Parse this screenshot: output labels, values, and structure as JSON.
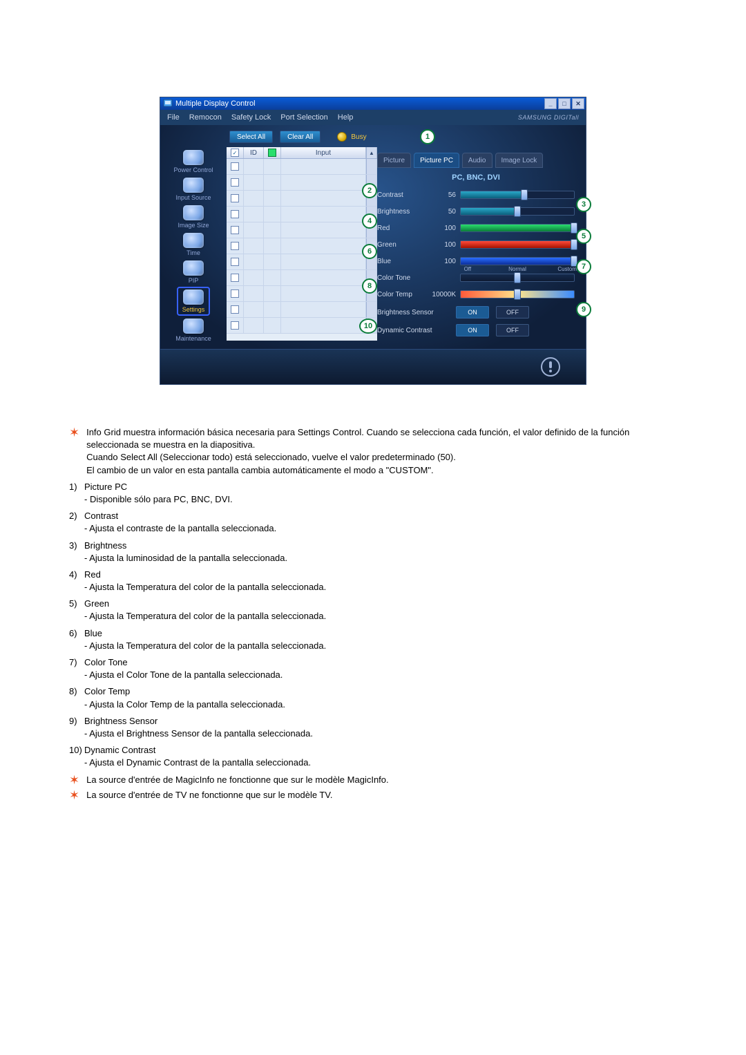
{
  "window": {
    "title": "Multiple Display Control",
    "brand": "SAMSUNG DIGITall"
  },
  "menu": {
    "file": "File",
    "remocon": "Remocon",
    "safety_lock": "Safety Lock",
    "port_selection": "Port Selection",
    "help": "Help"
  },
  "sidebar": {
    "items": [
      {
        "label": "Power Control"
      },
      {
        "label": "Input Source"
      },
      {
        "label": "Image Size"
      },
      {
        "label": "Time"
      },
      {
        "label": "PIP"
      },
      {
        "label": "Settings"
      },
      {
        "label": "Maintenance"
      }
    ]
  },
  "toolbar": {
    "select_all": "Select All",
    "clear_all": "Clear All",
    "busy": "Busy"
  },
  "grid": {
    "hdr_id": "ID",
    "hdr_input": "Input"
  },
  "tabs": {
    "picture": "Picture",
    "picture_pc": "Picture PC",
    "audio": "Audio",
    "image_lock": "Image Lock"
  },
  "panel": {
    "subtitle": "PC, BNC, DVI",
    "contrast": {
      "label": "Contrast",
      "value": "56",
      "pct": 56
    },
    "brightness": {
      "label": "Brightness",
      "value": "50",
      "pct": 50
    },
    "red": {
      "label": "Red",
      "value": "100",
      "pct": 100
    },
    "green": {
      "label": "Green",
      "value": "100",
      "pct": 100
    },
    "blue": {
      "label": "Blue",
      "value": "100",
      "pct": 100
    },
    "color_tone": {
      "label": "Color Tone",
      "ticks": [
        "Off",
        "Normal",
        "Custom"
      ],
      "pos": 50
    },
    "color_temp": {
      "label": "Color Temp",
      "value": "10000K",
      "pos": 50
    },
    "brightness_sensor": {
      "label": "Brightness Sensor",
      "on": "ON",
      "off": "OFF"
    },
    "dynamic_contrast": {
      "label": "Dynamic Contrast",
      "on": "ON",
      "off": "OFF"
    }
  },
  "callouts": {
    "c1": "1",
    "c2": "2",
    "c3": "3",
    "c4": "4",
    "c5": "5",
    "c6": "6",
    "c7": "7",
    "c8": "8",
    "c9": "9",
    "c10": "10"
  },
  "explain": {
    "intro1": "Info Grid muestra información básica necesaria para Settings Control. Cuando se selecciona cada función, el valor definido de la función seleccionada se muestra en la diapositiva.",
    "intro2": "Cuando Select All (Seleccionar todo) está seleccionado, vuelve el valor predeterminado (50).",
    "intro3": "El cambio de un valor en esta pantalla cambia automáticamente el modo a \"CUSTOM\".",
    "items": [
      {
        "n": "1)",
        "t": "Picture PC",
        "s": "- Disponible sólo para PC, BNC, DVI."
      },
      {
        "n": "2)",
        "t": "Contrast",
        "s": "- Ajusta el contraste de la pantalla seleccionada."
      },
      {
        "n": "3)",
        "t": "Brightness",
        "s": "- Ajusta la luminosidad de la pantalla seleccionada."
      },
      {
        "n": "4)",
        "t": "Red",
        "s": "- Ajusta la Temperatura del color de la pantalla seleccionada."
      },
      {
        "n": "5)",
        "t": "Green",
        "s": "- Ajusta la Temperatura del color de la pantalla seleccionada."
      },
      {
        "n": "6)",
        "t": "Blue",
        "s": "- Ajusta la Temperatura del color de la pantalla seleccionada."
      },
      {
        "n": "7)",
        "t": "Color Tone",
        "s": "- Ajusta el Color Tone de la pantalla seleccionada."
      },
      {
        "n": "8)",
        "t": "Color Temp",
        "s": "- Ajusta la Color Temp de la pantalla seleccionada."
      },
      {
        "n": "9)",
        "t": "Brightness Sensor",
        "s": "- Ajusta el Brightness Sensor de la pantalla seleccionada."
      },
      {
        "n": "10)",
        "t": "Dynamic Contrast",
        "s": "- Ajusta el Dynamic Contrast de la pantalla seleccionada."
      }
    ],
    "note1": "La source d'entrée de MagicInfo ne fonctionne que sur le modèle MagicInfo.",
    "note2": "La source d'entrée de TV ne fonctionne que sur le modèle TV."
  }
}
